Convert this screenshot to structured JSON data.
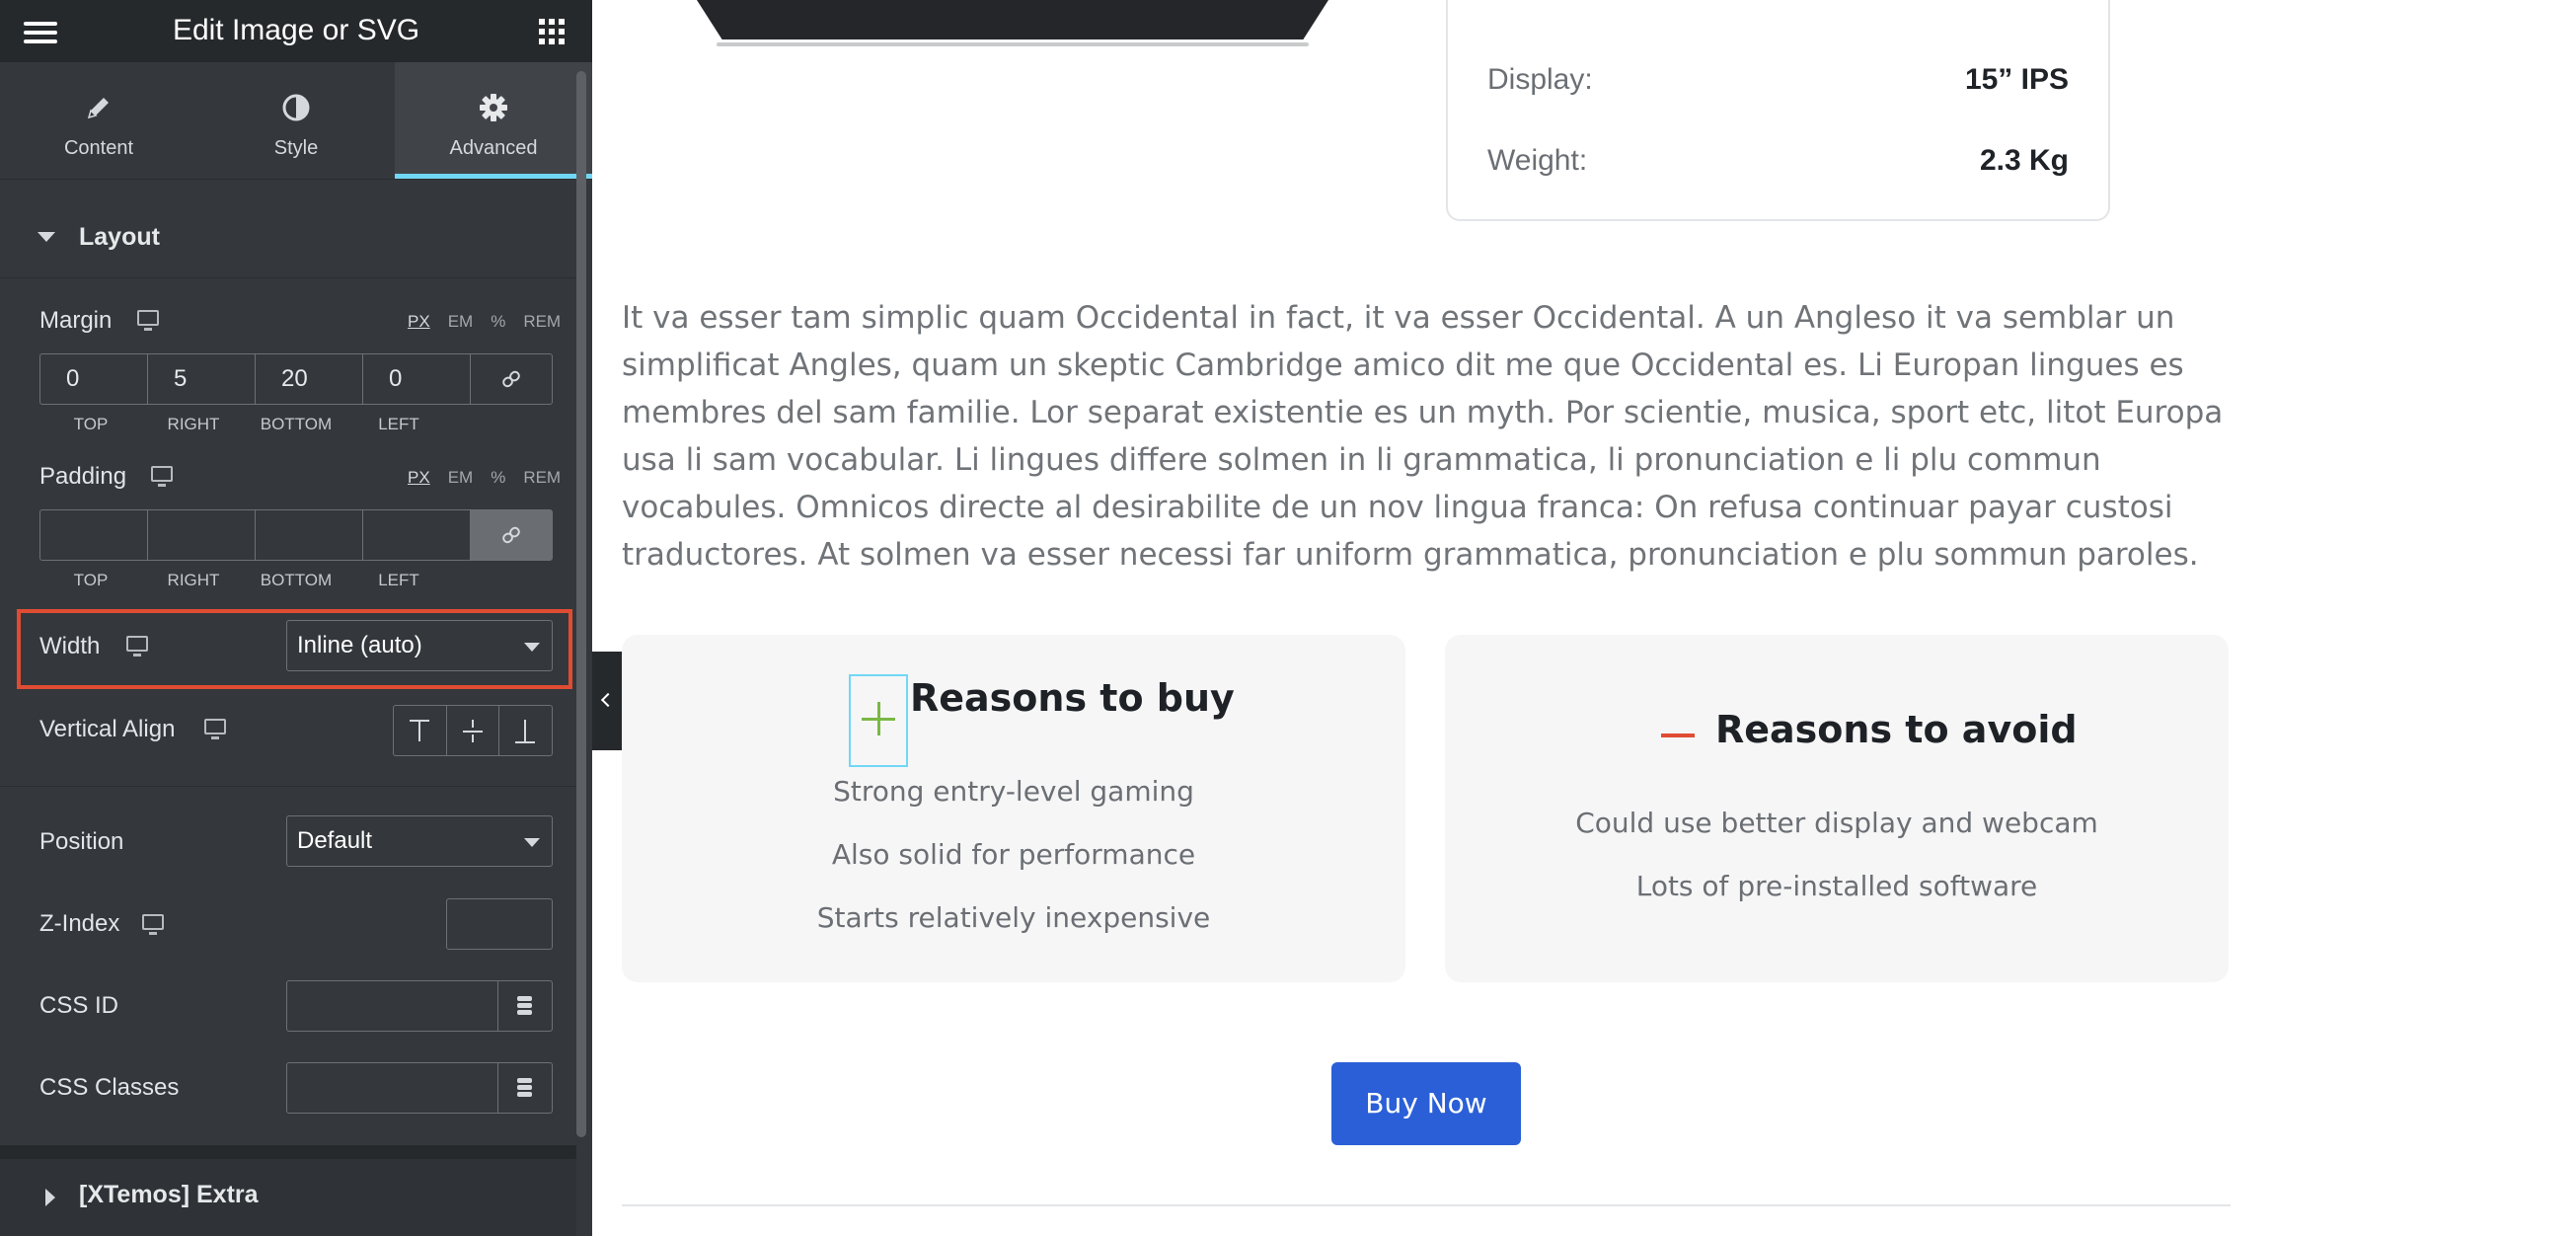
{
  "panel": {
    "title": "Edit Image or SVG",
    "tabs": [
      {
        "label": "Content",
        "icon": "pencil-icon"
      },
      {
        "label": "Style",
        "icon": "half-circle-icon"
      },
      {
        "label": "Advanced",
        "icon": "gear-icon",
        "active": true
      }
    ],
    "layout_section": {
      "title": "Layout",
      "margin": {
        "label": "Margin",
        "units": [
          "PX",
          "EM",
          "%",
          "REM"
        ],
        "selected_unit": "PX",
        "values": [
          "0",
          "5",
          "20",
          "0"
        ],
        "sides": [
          "TOP",
          "RIGHT",
          "BOTTOM",
          "LEFT"
        ]
      },
      "padding": {
        "label": "Padding",
        "units": [
          "PX",
          "EM",
          "%",
          "REM"
        ],
        "selected_unit": "PX",
        "values": [
          "",
          "",
          "",
          ""
        ],
        "sides": [
          "TOP",
          "RIGHT",
          "BOTTOM",
          "LEFT"
        ]
      },
      "width": {
        "label": "Width",
        "value": "Inline (auto)"
      },
      "vertical_align": {
        "label": "Vertical Align"
      },
      "position": {
        "label": "Position",
        "value": "Default"
      },
      "z_index": {
        "label": "Z-Index",
        "value": ""
      },
      "css_id": {
        "label": "CSS ID",
        "value": ""
      },
      "css_classes": {
        "label": "CSS Classes",
        "value": ""
      }
    },
    "extra_section": {
      "title": "[XTemos] Extra"
    }
  },
  "preview": {
    "specs": [
      {
        "key": "Display:",
        "value": "15” IPS"
      },
      {
        "key": "Weight:",
        "value": "2.3 Kg"
      }
    ],
    "paragraph": "It va esser tam simplic quam Occidental in fact, it va esser Occidental. A un Angleso it va semblar un simplificat Angles, quam un skeptic Cambridge amico dit me que Occidental es. Li Europan lingues es membres del sam familie. Lor separat existentie es un myth. Por scientie, musica, sport etc, litot Europa usa li sam vocabular. Li lingues differe solmen in li grammatica, li pronunciation e li plu commun vocabules. Omnicos directe al desirabilite de un nov lingua franca: On refusa continuar payar custosi traductores. At solmen va esser necessi far uniform grammatica, pronunciation e plu sommun paroles.",
    "reasons_buy": {
      "title": "Reasons to buy",
      "items": [
        "Strong entry-level gaming",
        "Also solid for performance",
        "Starts relatively inexpensive"
      ]
    },
    "reasons_avoid": {
      "title": "Reasons to avoid",
      "items": [
        "Could use better display and webcam",
        "Lots of pre-installed software"
      ]
    },
    "buy_button": "Buy Now"
  },
  "colors": {
    "panel_bg": "#34383c",
    "header_bg": "#26292c",
    "active_tab_underline": "#71d7f7",
    "highlight_border": "#e04c32",
    "buy_button": "#2a5fd7",
    "plus_icon": "#7ab845",
    "minus_icon": "#e04c32"
  }
}
